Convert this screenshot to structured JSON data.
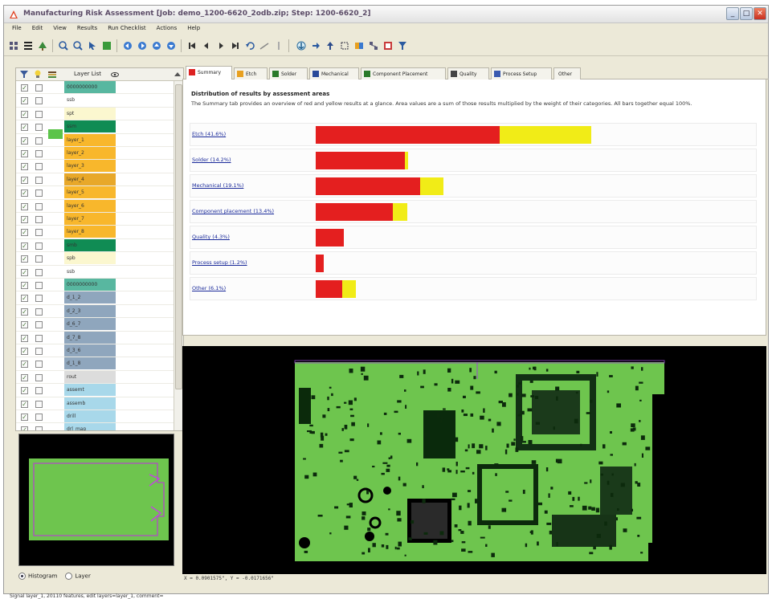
{
  "window": {
    "title": "Manufacturing Risk Assessment [Job: demo_1200-6620_2odb.zip; Step: 1200-6620_2]",
    "controls": [
      "_",
      "□",
      "✕"
    ]
  },
  "menu": [
    "File",
    "Edit",
    "View",
    "Results",
    "Run Checklist",
    "Actions",
    "Help"
  ],
  "layer_panel": {
    "header_label": "Layer List",
    "layers": [
      {
        "name": "0000000000",
        "color": "#58b7a0",
        "checked": true
      },
      {
        "name": "ssb",
        "color": "#ffffff",
        "checked": true
      },
      {
        "name": "spt",
        "color": "#fbf7cf",
        "checked": true
      },
      {
        "name": "ssm",
        "color": "#108c54",
        "checked": true
      },
      {
        "name": "layer_1",
        "color": "#f8b72c",
        "checked": true
      },
      {
        "name": "layer_2",
        "color": "#f8b72c",
        "checked": true
      },
      {
        "name": "layer_3",
        "color": "#f8b72c",
        "checked": true
      },
      {
        "name": "layer_4",
        "color": "#e8a82a",
        "checked": true
      },
      {
        "name": "layer_5",
        "color": "#f8b72c",
        "checked": true
      },
      {
        "name": "layer_6",
        "color": "#f8b72c",
        "checked": true
      },
      {
        "name": "layer_7",
        "color": "#f8b72c",
        "checked": true
      },
      {
        "name": "layer_8",
        "color": "#f8b72c",
        "checked": true
      },
      {
        "name": "smb",
        "color": "#108c54",
        "checked": true
      },
      {
        "name": "spb",
        "color": "#fbf7cf",
        "checked": true
      },
      {
        "name": "ssb",
        "color": "#ffffff",
        "checked": true
      },
      {
        "name": "0000000000",
        "color": "#58b7a0",
        "checked": true
      },
      {
        "name": "d_1_2",
        "color": "#8fa6bd",
        "checked": true
      },
      {
        "name": "d_2_3",
        "color": "#8fa6bd",
        "checked": true
      },
      {
        "name": "d_6_7",
        "color": "#8fa6bd",
        "checked": true
      },
      {
        "name": "d_7_8",
        "color": "#8fa6bd",
        "checked": true
      },
      {
        "name": "d_3_6",
        "color": "#8fa6bd",
        "checked": true
      },
      {
        "name": "d_1_8",
        "color": "#8fa6bd",
        "checked": true
      },
      {
        "name": "rout",
        "color": "#dcdcdc",
        "checked": true
      },
      {
        "name": "assemt",
        "color": "#a8d8ea",
        "checked": true
      },
      {
        "name": "assemb",
        "color": "#a8d8ea",
        "checked": true
      },
      {
        "name": "drill",
        "color": "#a8d8ea",
        "checked": true
      },
      {
        "name": "drl_map",
        "color": "#a8d8ea",
        "checked": true
      }
    ]
  },
  "tabs": [
    {
      "label": "Summary",
      "active": true,
      "icon_color": "#d22"
    },
    {
      "label": "Etch",
      "active": false,
      "icon_color": "#e8a020"
    },
    {
      "label": "Solder",
      "active": false,
      "icon_color": "#2a7a2a"
    },
    {
      "label": "Mechanical",
      "active": false,
      "icon_color": "#2a4a9a"
    },
    {
      "label": "Component Placement",
      "active": false,
      "icon_color": "#2a7a2a"
    },
    {
      "label": "Quality",
      "active": false,
      "icon_color": "#444"
    },
    {
      "label": "Process Setup",
      "active": false,
      "icon_color": "#3a5ab0"
    },
    {
      "label": "Other",
      "active": false,
      "icon_color": ""
    }
  ],
  "summary": {
    "heading": "Distribution of results by assessment areas",
    "description": "The Summary tab provides an overview of red and yellow results at a glance.   Area values are a sum of those results multiplied by the weight of their categories.   All bars together equal 100%.",
    "areas": [
      {
        "label": "Etch (41.6%)",
        "red_pct": 41.6,
        "yellow_pct": 20.8
      },
      {
        "label": "Solder (14.2%)",
        "red_pct": 20.2,
        "yellow_pct": 0.8
      },
      {
        "label": "Mechanical (19.1%)",
        "red_pct": 23.6,
        "yellow_pct": 5.4
      },
      {
        "label": "Component placement (13.4%)",
        "red_pct": 17.4,
        "yellow_pct": 3.3
      },
      {
        "label": "Quality (4.3%)",
        "red_pct": 6.4,
        "yellow_pct": 0
      },
      {
        "label": "Process setup (1.2%)",
        "red_pct": 1.9,
        "yellow_pct": 0
      },
      {
        "label": "Other (6.1%)",
        "red_pct": 6.0,
        "yellow_pct": 3.0
      }
    ],
    "colors": {
      "red": "#e41f1f",
      "yellow": "#f1ec17"
    }
  },
  "mini_view": {
    "radio_histogram": "Histogram",
    "radio_layer": "Layer",
    "selected": "Histogram"
  },
  "coords": "X = 0.0901575\", Y = -0.0171656\"",
  "statusbar": "Signal layer_1, 20110 features, edit layers=layer_1, comment="
}
